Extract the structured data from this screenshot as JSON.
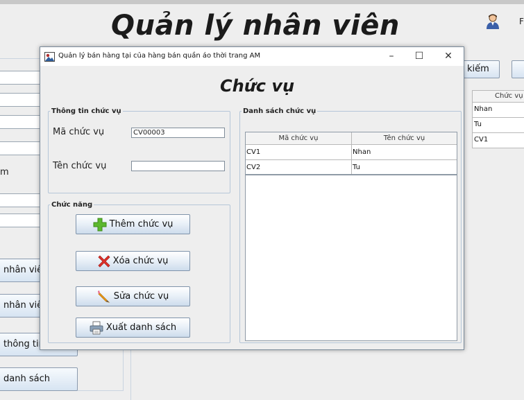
{
  "app": {
    "title": "Quản lý nhân viên",
    "user_text": "F"
  },
  "background": {
    "partial_label": "m",
    "buttons": [
      "nhân viê",
      "nhân viên",
      "thông tin",
      "danh sách"
    ],
    "search_label": "kiếm",
    "table": {
      "header": "Chức vụ",
      "rows": [
        "Nhan",
        "Tu",
        "CV1"
      ]
    }
  },
  "dialog": {
    "window_title": "Quản lý bán hàng tại của hàng bán quần áo thời trang AM",
    "controls": {
      "minimize": "–",
      "maximize": "☐",
      "close": "✕"
    },
    "heading": "Chức vụ",
    "info_group": {
      "legend": "Thông tin chức vụ",
      "code_label": "Mã chức vụ",
      "code_value": "CV00003",
      "name_label": "Tên chức vụ",
      "name_value": ""
    },
    "func_group": {
      "legend": "Chức năng",
      "buttons": {
        "add": "Thêm chức vụ",
        "delete": "Xóa chức vụ",
        "edit": "Sửa chức vụ",
        "export": "Xuất danh sách"
      }
    },
    "list_group": {
      "legend": "Danh sách chức vụ",
      "columns": [
        "Mã chức vụ",
        "Tên chức vụ"
      ],
      "rows": [
        [
          "CV1",
          "Nhan"
        ],
        [
          "CV2",
          "Tu"
        ]
      ]
    }
  },
  "icons": {
    "add": "plus-icon",
    "delete": "x-icon",
    "edit": "pencil-icon",
    "export": "printer-icon",
    "user": "user-icon"
  },
  "colors": {
    "add_icon": "#5cb82e",
    "delete_icon": "#e0322b",
    "edit_icon": "#f2a21a",
    "group_border": "#b5c6d8"
  }
}
